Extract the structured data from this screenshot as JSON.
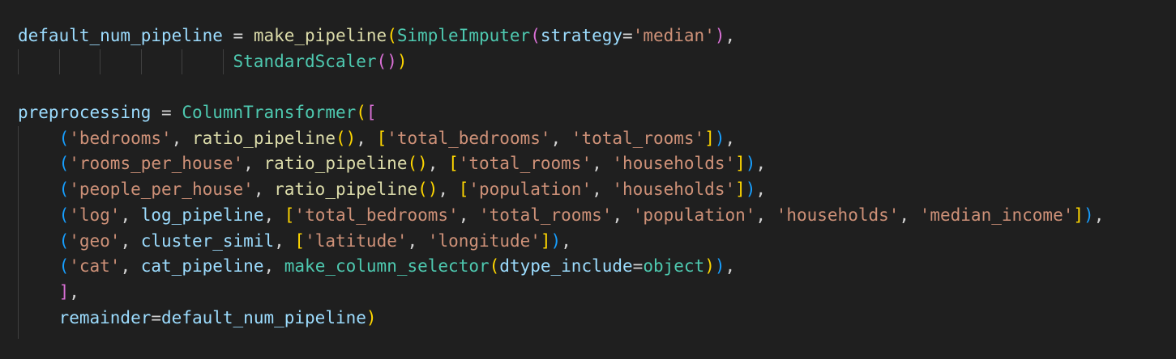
{
  "editor": {
    "lines": [
      [
        {
          "t": "default_num_pipeline",
          "k": "var"
        },
        {
          "t": " = ",
          "k": "op"
        },
        {
          "t": "make_pipeline",
          "k": "fn"
        },
        {
          "t": "(",
          "k": "b1"
        },
        {
          "t": "SimpleImputer",
          "k": "cls"
        },
        {
          "t": "(",
          "k": "b2"
        },
        {
          "t": "strategy",
          "k": "var"
        },
        {
          "t": "=",
          "k": "op"
        },
        {
          "t": "'median'",
          "k": "str"
        },
        {
          "t": ")",
          "k": "b2"
        },
        {
          "t": ",",
          "k": "op"
        }
      ],
      [
        {
          "t": "                     ",
          "k": "op"
        },
        {
          "t": "StandardScaler",
          "k": "cls"
        },
        {
          "t": "(",
          "k": "b2"
        },
        {
          "t": ")",
          "k": "b2"
        },
        {
          "t": ")",
          "k": "b1"
        }
      ],
      [],
      [
        {
          "t": "preprocessing",
          "k": "var"
        },
        {
          "t": " = ",
          "k": "op"
        },
        {
          "t": "ColumnTransformer",
          "k": "cls"
        },
        {
          "t": "(",
          "k": "b1"
        },
        {
          "t": "[",
          "k": "b2"
        }
      ],
      [
        {
          "t": "    ",
          "k": "op"
        },
        {
          "t": "(",
          "k": "b3"
        },
        {
          "t": "'bedrooms'",
          "k": "str"
        },
        {
          "t": ", ",
          "k": "op"
        },
        {
          "t": "ratio_pipeline",
          "k": "fn"
        },
        {
          "t": "()",
          "k": "b1"
        },
        {
          "t": ", ",
          "k": "op"
        },
        {
          "t": "[",
          "k": "b1"
        },
        {
          "t": "'total_bedrooms'",
          "k": "str"
        },
        {
          "t": ", ",
          "k": "op"
        },
        {
          "t": "'total_rooms'",
          "k": "str"
        },
        {
          "t": "]",
          "k": "b1"
        },
        {
          "t": ")",
          "k": "b3"
        },
        {
          "t": ",",
          "k": "op"
        }
      ],
      [
        {
          "t": "    ",
          "k": "op"
        },
        {
          "t": "(",
          "k": "b3"
        },
        {
          "t": "'rooms_per_house'",
          "k": "str"
        },
        {
          "t": ", ",
          "k": "op"
        },
        {
          "t": "ratio_pipeline",
          "k": "fn"
        },
        {
          "t": "()",
          "k": "b1"
        },
        {
          "t": ", ",
          "k": "op"
        },
        {
          "t": "[",
          "k": "b1"
        },
        {
          "t": "'total_rooms'",
          "k": "str"
        },
        {
          "t": ", ",
          "k": "op"
        },
        {
          "t": "'households'",
          "k": "str"
        },
        {
          "t": "]",
          "k": "b1"
        },
        {
          "t": ")",
          "k": "b3"
        },
        {
          "t": ",",
          "k": "op"
        }
      ],
      [
        {
          "t": "    ",
          "k": "op"
        },
        {
          "t": "(",
          "k": "b3"
        },
        {
          "t": "'people_per_house'",
          "k": "str"
        },
        {
          "t": ", ",
          "k": "op"
        },
        {
          "t": "ratio_pipeline",
          "k": "fn"
        },
        {
          "t": "()",
          "k": "b1"
        },
        {
          "t": ", ",
          "k": "op"
        },
        {
          "t": "[",
          "k": "b1"
        },
        {
          "t": "'population'",
          "k": "str"
        },
        {
          "t": ", ",
          "k": "op"
        },
        {
          "t": "'households'",
          "k": "str"
        },
        {
          "t": "]",
          "k": "b1"
        },
        {
          "t": ")",
          "k": "b3"
        },
        {
          "t": ",",
          "k": "op"
        }
      ],
      [
        {
          "t": "    ",
          "k": "op"
        },
        {
          "t": "(",
          "k": "b3"
        },
        {
          "t": "'log'",
          "k": "str"
        },
        {
          "t": ", ",
          "k": "op"
        },
        {
          "t": "log_pipeline",
          "k": "var"
        },
        {
          "t": ", ",
          "k": "op"
        },
        {
          "t": "[",
          "k": "b1"
        },
        {
          "t": "'total_bedrooms'",
          "k": "str"
        },
        {
          "t": ", ",
          "k": "op"
        },
        {
          "t": "'total_rooms'",
          "k": "str"
        },
        {
          "t": ", ",
          "k": "op"
        },
        {
          "t": "'population'",
          "k": "str"
        },
        {
          "t": ", ",
          "k": "op"
        },
        {
          "t": "'households'",
          "k": "str"
        },
        {
          "t": ", ",
          "k": "op"
        },
        {
          "t": "'median_income'",
          "k": "str"
        },
        {
          "t": "]",
          "k": "b1"
        },
        {
          "t": ")",
          "k": "b3"
        },
        {
          "t": ",",
          "k": "op"
        }
      ],
      [
        {
          "t": "    ",
          "k": "op"
        },
        {
          "t": "(",
          "k": "b3"
        },
        {
          "t": "'geo'",
          "k": "str"
        },
        {
          "t": ", ",
          "k": "op"
        },
        {
          "t": "cluster_simil",
          "k": "var"
        },
        {
          "t": ", ",
          "k": "op"
        },
        {
          "t": "[",
          "k": "b1"
        },
        {
          "t": "'latitude'",
          "k": "str"
        },
        {
          "t": ", ",
          "k": "op"
        },
        {
          "t": "'longitude'",
          "k": "str"
        },
        {
          "t": "]",
          "k": "b1"
        },
        {
          "t": ")",
          "k": "b3"
        },
        {
          "t": ",",
          "k": "op"
        }
      ],
      [
        {
          "t": "    ",
          "k": "op"
        },
        {
          "t": "(",
          "k": "b3"
        },
        {
          "t": "'cat'",
          "k": "str"
        },
        {
          "t": ", ",
          "k": "op"
        },
        {
          "t": "cat_pipeline",
          "k": "var"
        },
        {
          "t": ", ",
          "k": "op"
        },
        {
          "t": "make_column_selector",
          "k": "cls"
        },
        {
          "t": "(",
          "k": "b1"
        },
        {
          "t": "dtype_include",
          "k": "var"
        },
        {
          "t": "=",
          "k": "op"
        },
        {
          "t": "object",
          "k": "cls"
        },
        {
          "t": ")",
          "k": "b1"
        },
        {
          "t": ")",
          "k": "b3"
        },
        {
          "t": ",",
          "k": "op"
        }
      ],
      [
        {
          "t": "    ",
          "k": "op"
        },
        {
          "t": "]",
          "k": "b2"
        },
        {
          "t": ",",
          "k": "op"
        }
      ],
      [
        {
          "t": "    ",
          "k": "op"
        },
        {
          "t": "remainder",
          "k": "var"
        },
        {
          "t": "=",
          "k": "op"
        },
        {
          "t": "default_num_pipeline",
          "k": "var"
        },
        {
          "t": ")",
          "k": "b1"
        }
      ]
    ]
  }
}
